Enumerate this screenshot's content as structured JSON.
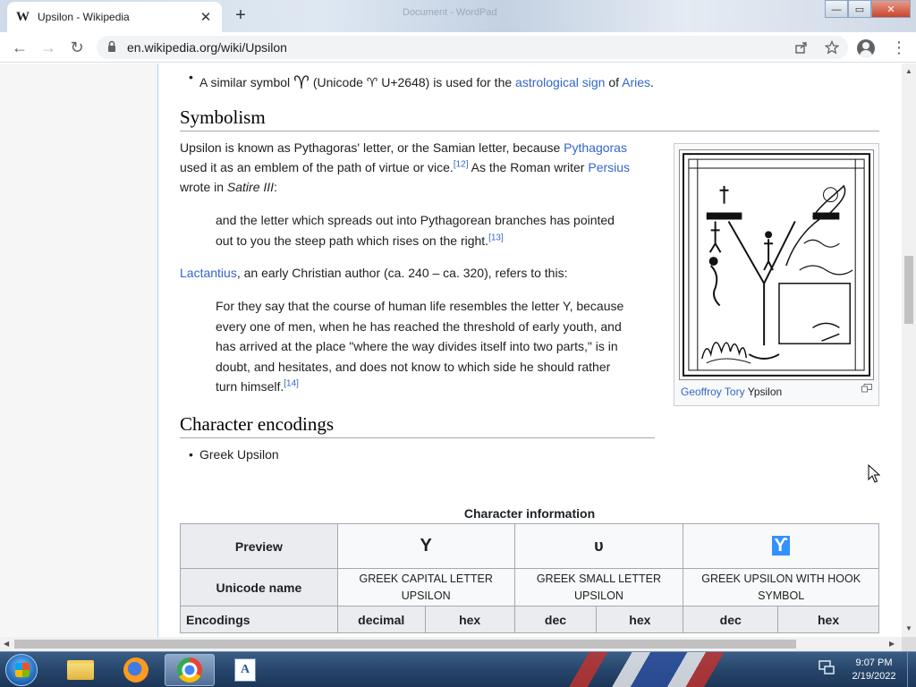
{
  "browser": {
    "tab": {
      "favicon": "W",
      "title": "Upsilon - Wikipedia",
      "close": "✕"
    },
    "new_tab": "+",
    "background_tab_title": "Document - WordPad",
    "window_controls": {
      "minimize": "—",
      "maximize": "▭",
      "close": "✕"
    },
    "nav": {
      "back": "←",
      "forward": "→",
      "reload": "↻"
    },
    "url": "en.wikipedia.org/wiki/Upsilon",
    "icons": [
      "lock-icon",
      "share-icon",
      "star-icon",
      "profile-icon",
      "menu-icon"
    ]
  },
  "article": {
    "bullet_aries": {
      "before": "A similar symbol",
      "glyph": "♈",
      "mid": "(Unicode ♈ U+2648) is used for the",
      "link1": "astrological sign",
      "of": "of",
      "link2": "Aries",
      "period": "."
    },
    "symbolism": {
      "heading": "Symbolism",
      "p1_a": "Upsilon is known as Pythagoras' letter, or the Samian letter, because",
      "p1_link": "Pythagoras",
      "p1_b": "used it as an emblem of the path of virtue or vice.",
      "p1_ref": "[12]",
      "p1_c": "As the Roman writer",
      "p1_link2": "Persius",
      "p1_d": "wrote in",
      "p1_italic": "Satire III",
      "p1_colon": ":",
      "quote1": "and the letter which spreads out into Pythagorean branches has pointed out to you the steep path which rises on the right.",
      "quote1_ref": "[13]",
      "p2_link": "Lactantius",
      "p2_text": ", an early Christian author (ca. 240 – ca. 320), refers to this:",
      "quote2": "For they say that the course of human life resembles the letter Y, because every one of men, when he has reached the threshold of early youth, and has arrived at the place \"where the way divides itself into two parts,\" is in doubt, and hesitates, and does not know to which side he should rather turn himself.",
      "quote2_ref": "[14]"
    },
    "thumbnail": {
      "caption_link": "Geoffroy Tory",
      "caption_text": "Ypsilon"
    },
    "encodings": {
      "heading": "Character encodings",
      "bullet": "Greek Upsilon"
    },
    "table": {
      "caption": "Character information",
      "preview_label": "Preview",
      "previews": [
        "Υ",
        "υ",
        "ϒ"
      ],
      "unicode_name_label": "Unicode name",
      "names": [
        "GREEK CAPITAL LETTER UPSILON",
        "GREEK SMALL LETTER UPSILON",
        "GREEK UPSILON WITH HOOK SYMBOL"
      ],
      "encodings_label": "Encodings",
      "enc_headers": [
        "decimal",
        "hex",
        "dec",
        "hex",
        "dec",
        "hex"
      ]
    }
  },
  "taskbar": {
    "items": [
      "start-button",
      "explorer",
      "firefox",
      "chrome",
      "wordpad"
    ],
    "time": "9:07 PM",
    "date": "2/19/2022"
  }
}
